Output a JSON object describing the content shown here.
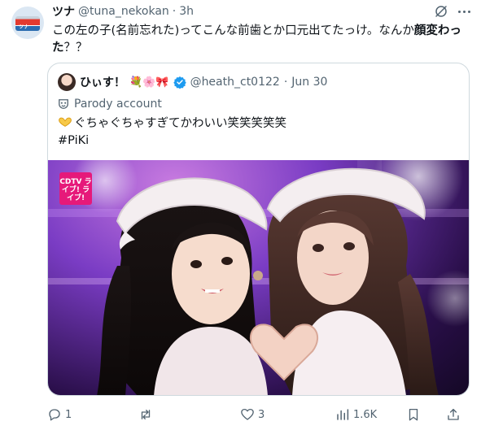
{
  "author": {
    "name": "ツナ",
    "handle": "@tuna_nekokan",
    "separator": "·",
    "time": "3h",
    "avatar_label": "ツナ"
  },
  "tweet": {
    "text_before": "この左の子(名前忘れた)ってこんな前歯とか口元出てたっけ。なんか",
    "text_bold": "顔変わった",
    "text_after": "？？"
  },
  "quote": {
    "name": "ひぃす！",
    "emojis": "💐🌸🎀",
    "handle": "@heath_ct0122",
    "separator": "·",
    "date": "Jun 30",
    "parody_label": "Parody account",
    "text_line1": "ぐちゃぐちゃすぎてかわいい笑笑笑笑笑",
    "text_line2": "#PiKi",
    "media_logo": "CDTV ライブ! ライブ!"
  },
  "actions": {
    "replies": "1",
    "reposts": "",
    "likes": "3",
    "views": "1.6K"
  },
  "colors": {
    "secondary_text": "#536471",
    "verified": "#1d9bf0",
    "border": "#cfd9de"
  }
}
